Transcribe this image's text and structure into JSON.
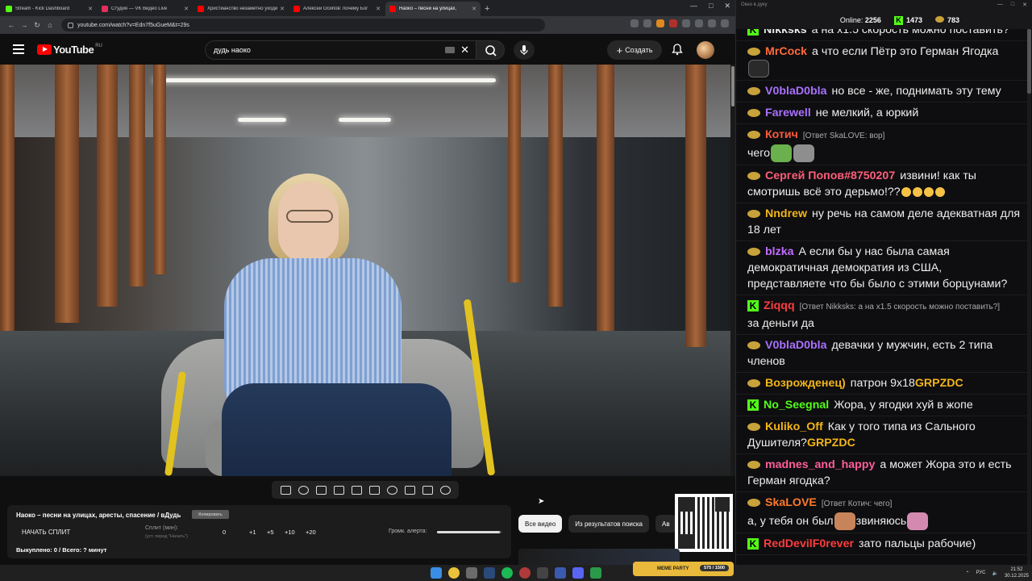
{
  "browser": {
    "tabs": [
      {
        "label": "Stream - Kick Dashboard",
        "color": "#53fc18",
        "active": false
      },
      {
        "label": "Студия — VK Видео Live",
        "color": "#e52d5b",
        "active": false
      },
      {
        "label": "Христианство незаметно уходит",
        "color": "#ff0000",
        "active": false
      },
      {
        "label": "Алексей Осипов: почему Бог",
        "color": "#ff0000",
        "active": false
      },
      {
        "label": "Наоко – песни на улицах,",
        "color": "#ff0000",
        "active": true
      }
    ],
    "url": "youtube.com/watch?v=Edn7f5uGueM&t=29s"
  },
  "youtube": {
    "logo_text": "YouTube",
    "region": "RU",
    "search_value": "дудь наоко",
    "create_label": "Создать"
  },
  "alert_panel": {
    "title": "Наоко – песни на улицах, аресты, спасение / вДудь",
    "copy_label": "Копировать",
    "start_split": "НАЧАТЬ СПЛИТ",
    "split_label": "Сплит (мин):",
    "split_hint": "(уст. перед \"Начать\")",
    "split_values": [
      "0",
      "+1",
      "+5",
      "+10",
      "+20"
    ],
    "volume_label": "Громк. алерта:",
    "volume_level": 0.98,
    "bought": "Выкуплено: 0 / Всего: ? минут"
  },
  "chips": [
    "Все видео",
    "Из результатов поиска",
    "Ав"
  ],
  "chat": {
    "window_title": "Окно в дуку",
    "online_label": "Online:",
    "online_count": "2256",
    "kick_count": "1473",
    "coin_count": "783",
    "messages": [
      {
        "badge": "k",
        "user": "Nikksks",
        "color": "#e9e9e9",
        "text": "а на x1.5 скорость можно поставить?"
      },
      {
        "badge": "c",
        "user": "MrCock",
        "color": "#ff6a3c",
        "text": "а что если Пётр это Герман Ягодка"
      },
      {
        "badge": "c",
        "user": "V0blaD0bla",
        "color": "#a970ff",
        "text": "но все - же, поднимать эту тему"
      },
      {
        "badge": "c",
        "user": "Farewell",
        "color": "#a970ff",
        "text": "не мелкий, а юркий"
      },
      {
        "badge": "c",
        "user": "Котич",
        "color": "#ff5a3c",
        "reply": "[Ответ SkaLOVE: вор]",
        "text": "чего"
      },
      {
        "badge": "c",
        "user": "Сергей Попов#8750207",
        "color": "#ff5e7a",
        "text": "извини! как ты смотришь всё это дерьмо!??"
      },
      {
        "badge": "c",
        "user": "Nndrew",
        "color": "#f2b51a",
        "text": "ну речь на самом деле адекватная для 18 лет"
      },
      {
        "badge": "c",
        "user": "blzka",
        "color": "#c06cff",
        "text": "А если бы у нас была самая демократичная демократия из США, представляете что бы было с этими борцунами?"
      },
      {
        "badge": "k",
        "user": "Ziqqq",
        "color": "#ff3c3c",
        "reply": "[Ответ Nikksks: а на x1.5 скорость можно поставить?]",
        "text": "за деньги да"
      },
      {
        "badge": "c",
        "user": "V0blaD0bla",
        "color": "#a970ff",
        "text": "девачки у мужчин, есть 2 типа членов"
      },
      {
        "badge": "c",
        "user": "Возрожденец)",
        "color": "#f2b51a",
        "text": "патрон 9x18",
        "hl": "GRPZDC"
      },
      {
        "badge": "k",
        "user": "No_Seegnal",
        "color": "#53fc18",
        "text": "Жора, у ягодки хуй в жопе"
      },
      {
        "badge": "c",
        "user": "Kuliko_Off",
        "color": "#f2b51a",
        "text": "Как у того типа из Сального Душителя?",
        "hl": "GRPZDC"
      },
      {
        "badge": "c",
        "user": "madnes_and_happy",
        "color": "#ff5e9a",
        "text": "а может Жора это и есть Герман ягодка?"
      },
      {
        "badge": "c",
        "user": "SkaLOVE",
        "color": "#ff7a2c",
        "reply": "[Ответ Котич: чего]",
        "text": "а, у тебя он был",
        "text2": "звиняюсь"
      },
      {
        "badge": "k",
        "user": "RedDevilF0rever",
        "color": "#ff3c3c",
        "text": "зато пальцы рабочие)"
      }
    ]
  },
  "meme_party": {
    "label": "MEME PARTY",
    "progress": "575 / 1500"
  },
  "taskbar": {
    "lang": "РУС",
    "time": "21:52",
    "date": "30.12.2025"
  }
}
